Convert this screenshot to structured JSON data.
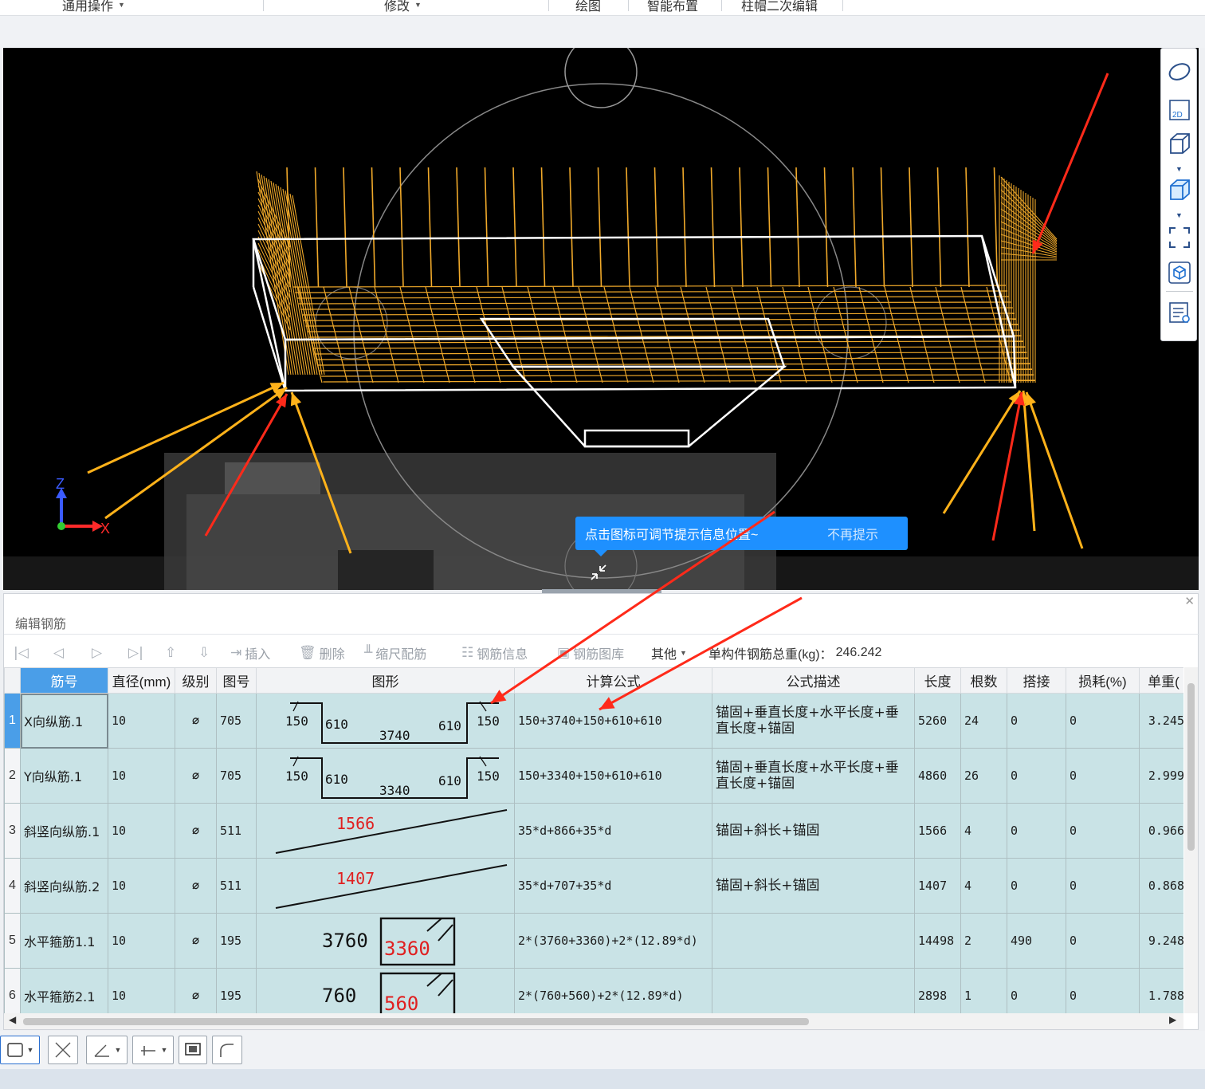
{
  "ribbon": {
    "groups": [
      "通用操作",
      "修改",
      "绘图",
      "智能布置",
      "柱帽二次编辑"
    ]
  },
  "viewport": {
    "axis_x": "X",
    "axis_z": "Z",
    "hint_text": "点击图标可调节提示信息位置~",
    "hint_dismiss": "不再提示"
  },
  "right_toolbar": {
    "tools": [
      "orbit-icon",
      "view-2d-icon",
      "cube-icon",
      "solid-cube-icon",
      "fullscreen-icon",
      "view-cube-icon",
      "display-settings-icon"
    ],
    "label_2d": "2D"
  },
  "editor": {
    "title": "编辑钢筋",
    "toolbar": {
      "insert": "插入",
      "delete": "删除",
      "scale": "缩尺配筋",
      "info": "钢筋信息",
      "library": "钢筋图库",
      "other": "其他",
      "total_weight_label": "单构件钢筋总重(kg)：",
      "total_weight_value": "246.242"
    },
    "columns": [
      "筋号",
      "直径(mm)",
      "级别",
      "图号",
      "图形",
      "计算公式",
      "公式描述",
      "长度",
      "根数",
      "搭接",
      "损耗(%)",
      "单重("
    ],
    "rows": [
      {
        "num": "1",
        "name": "X向纵筋.1",
        "dia": "10",
        "grade": "⌀",
        "fig": "705",
        "formula": "150+3740+150+610+610",
        "desc": "锚固+垂直长度+水平长度+垂直长度+锚固",
        "length": "5260",
        "count": "24",
        "lap": "0",
        "loss": "0",
        "unit": "3.245",
        "shape": {
          "type": "channel",
          "left_tail": "150",
          "left_leg": "610",
          "bottom": "3740",
          "right_leg": "610",
          "right_tail": "150"
        }
      },
      {
        "num": "2",
        "name": "Y向纵筋.1",
        "dia": "10",
        "grade": "⌀",
        "fig": "705",
        "formula": "150+3340+150+610+610",
        "desc": "锚固+垂直长度+水平长度+垂直长度+锚固",
        "length": "4860",
        "count": "26",
        "lap": "0",
        "loss": "0",
        "unit": "2.999",
        "shape": {
          "type": "channel",
          "left_tail": "150",
          "left_leg": "610",
          "bottom": "3340",
          "right_leg": "610",
          "right_tail": "150"
        }
      },
      {
        "num": "3",
        "name": "斜竖向纵筋.1",
        "dia": "10",
        "grade": "⌀",
        "fig": "511",
        "formula": "35*d+866+35*d",
        "desc": "锚固+斜长+锚固",
        "length": "1566",
        "count": "4",
        "lap": "0",
        "loss": "0",
        "unit": "0.966",
        "shape": {
          "type": "slope",
          "label": "1566"
        }
      },
      {
        "num": "4",
        "name": "斜竖向纵筋.2",
        "dia": "10",
        "grade": "⌀",
        "fig": "511",
        "formula": "35*d+707+35*d",
        "desc": "锚固+斜长+锚固",
        "length": "1407",
        "count": "4",
        "lap": "0",
        "loss": "0",
        "unit": "0.868",
        "shape": {
          "type": "slope",
          "label": "1407"
        }
      },
      {
        "num": "5",
        "name": "水平箍筋1.1",
        "dia": "10",
        "grade": "⌀",
        "fig": "195",
        "formula": "2*(3760+3360)+2*(12.89*d)",
        "desc": "",
        "length": "14498",
        "count": "2",
        "lap": "490",
        "loss": "0",
        "unit": "9.248",
        "shape": {
          "type": "stirrup",
          "outer": "3760",
          "inner": "3360"
        }
      },
      {
        "num": "6",
        "name": "水平箍筋2.1",
        "dia": "10",
        "grade": "⌀",
        "fig": "195",
        "formula": "2*(760+560)+2*(12.89*d)",
        "desc": "",
        "length": "2898",
        "count": "1",
        "lap": "0",
        "loss": "0",
        "unit": "1.788",
        "shape": {
          "type": "stirrup",
          "outer": "760",
          "inner": "560"
        }
      }
    ]
  },
  "colors": {
    "rebar": "#f0a92a",
    "arrow_red": "#ff2a1a",
    "arrow_orange": "#ffb21a",
    "grid_row": "#c9e3e6",
    "header_active": "#4a9ee8",
    "hint_bg": "#1e90ff",
    "shape_label_red": "#e02020"
  }
}
